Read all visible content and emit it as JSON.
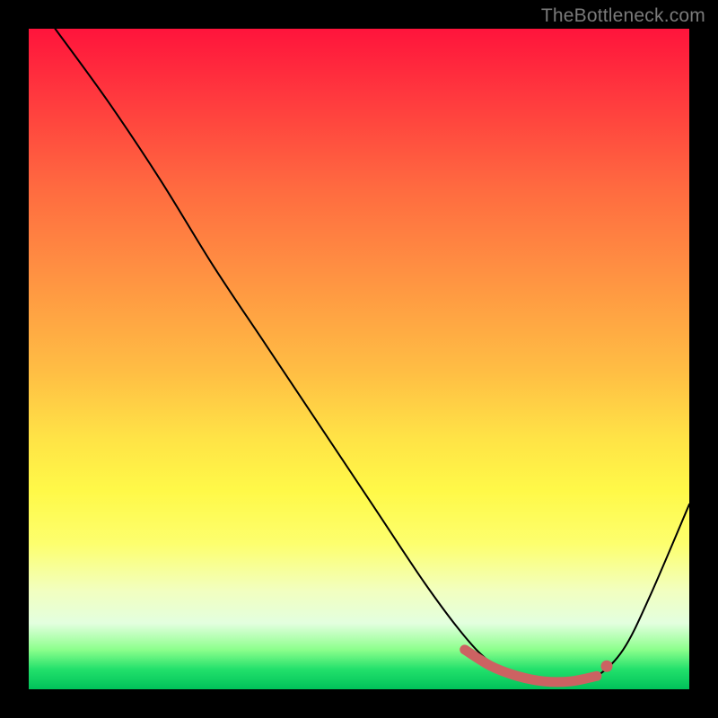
{
  "watermark": "TheBottleneck.com",
  "chart_data": {
    "type": "line",
    "title": "",
    "xlabel": "",
    "ylabel": "",
    "xlim": [
      0,
      100
    ],
    "ylim": [
      0,
      100
    ],
    "grid": false,
    "series": [
      {
        "name": "bottleneck-curve",
        "x": [
          4,
          12,
          20,
          28,
          36,
          44,
          52,
          60,
          66,
          70,
          74,
          78,
          82,
          86,
          90,
          94,
          100
        ],
        "y": [
          100,
          89,
          77,
          64,
          52,
          40,
          28,
          16,
          8,
          4,
          2,
          1,
          1,
          2,
          6,
          14,
          28
        ]
      },
      {
        "name": "optimal-region",
        "x": [
          66,
          70,
          74,
          78,
          82,
          86
        ],
        "y": [
          6,
          3.5,
          2,
          1.2,
          1.2,
          2
        ]
      }
    ],
    "annotations": [
      {
        "name": "optimal-end-dot",
        "x": 87.5,
        "y": 3.5
      }
    ],
    "gradient_stops": [
      {
        "pos": 0,
        "color": "#ff143c"
      },
      {
        "pos": 24,
        "color": "#ff6a40"
      },
      {
        "pos": 52,
        "color": "#ffbe44"
      },
      {
        "pos": 78,
        "color": "#fdff6e"
      },
      {
        "pos": 94,
        "color": "#8cff8c"
      },
      {
        "pos": 100,
        "color": "#00c25a"
      }
    ]
  }
}
